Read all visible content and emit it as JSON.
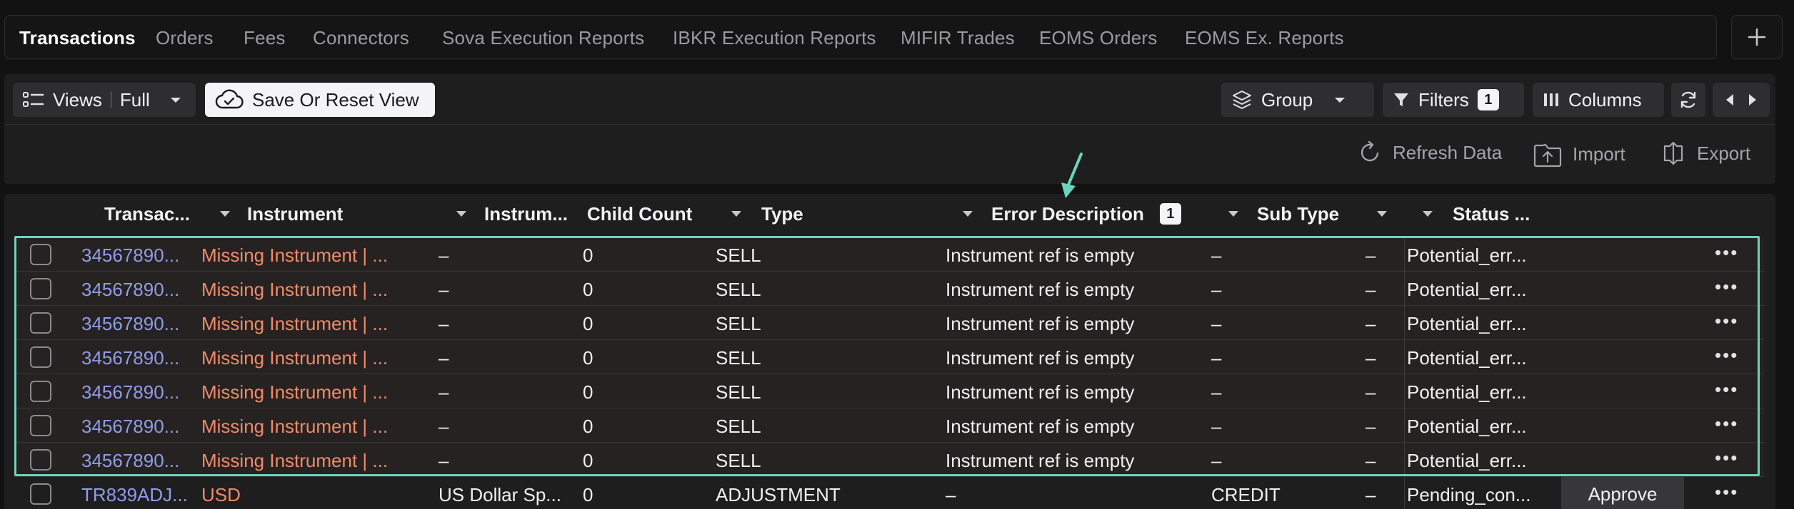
{
  "tabs": [
    {
      "label": "Transactions",
      "active": true
    },
    {
      "label": "Orders"
    },
    {
      "label": "Fees"
    },
    {
      "label": "Connectors"
    },
    {
      "label": "Sova Execution Reports"
    },
    {
      "label": "IBKR Execution Reports"
    },
    {
      "label": "MIFIR Trades"
    },
    {
      "label": "EOMS Orders"
    },
    {
      "label": "EOMS Ex. Reports"
    }
  ],
  "toolbar": {
    "views_label": "Views",
    "views_value": "Full",
    "save_reset_label": "Save Or Reset View",
    "group_label": "Group",
    "filters_label": "Filters",
    "filters_count": "1",
    "columns_label": "Columns"
  },
  "actions": {
    "refresh": "Refresh Data",
    "import": "Import",
    "export": "Export"
  },
  "columns": {
    "transaction": "Transac...",
    "instrument": "Instrument",
    "instrument2": "Instrum...",
    "child_count": "Child Count",
    "type": "Type",
    "error_description": "Error Description",
    "error_description_badge": "1",
    "sub_type": "Sub Type",
    "status": "Status ..."
  },
  "rows": [
    {
      "id": "34567890...",
      "instrument": "Missing Instrument | ...",
      "instrument2": "–",
      "child_count": "0",
      "type": "SELL",
      "error": "Instrument ref is empty",
      "sub_type": "–",
      "dash2": "–",
      "status": "Potential_err..."
    },
    {
      "id": "34567890...",
      "instrument": "Missing Instrument | ...",
      "instrument2": "–",
      "child_count": "0",
      "type": "SELL",
      "error": "Instrument ref is empty",
      "sub_type": "–",
      "dash2": "–",
      "status": "Potential_err..."
    },
    {
      "id": "34567890...",
      "instrument": "Missing Instrument | ...",
      "instrument2": "–",
      "child_count": "0",
      "type": "SELL",
      "error": "Instrument ref is empty",
      "sub_type": "–",
      "dash2": "–",
      "status": "Potential_err..."
    },
    {
      "id": "34567890...",
      "instrument": "Missing Instrument | ...",
      "instrument2": "–",
      "child_count": "0",
      "type": "SELL",
      "error": "Instrument ref is empty",
      "sub_type": "–",
      "dash2": "–",
      "status": "Potential_err..."
    },
    {
      "id": "34567890...",
      "instrument": "Missing Instrument | ...",
      "instrument2": "–",
      "child_count": "0",
      "type": "SELL",
      "error": "Instrument ref is empty",
      "sub_type": "–",
      "dash2": "–",
      "status": "Potential_err..."
    },
    {
      "id": "34567890...",
      "instrument": "Missing Instrument | ...",
      "instrument2": "–",
      "child_count": "0",
      "type": "SELL",
      "error": "Instrument ref is empty",
      "sub_type": "–",
      "dash2": "–",
      "status": "Potential_err..."
    },
    {
      "id": "34567890...",
      "instrument": "Missing Instrument | ...",
      "instrument2": "–",
      "child_count": "0",
      "type": "SELL",
      "error": "Instrument ref is empty",
      "sub_type": "–",
      "dash2": "–",
      "status": "Potential_err..."
    },
    {
      "id": "TR839ADJ...",
      "instrument": "USD",
      "instrument2": "US Dollar Sp...",
      "child_count": "0",
      "type": "ADJUSTMENT",
      "error": "–",
      "sub_type": "CREDIT",
      "dash2": "–",
      "status": "Pending_con...",
      "action": "Approve"
    }
  ],
  "colors": {
    "accent_highlight": "#6cd3bd",
    "link": "#8f9ce8",
    "error": "#f08a6a"
  }
}
